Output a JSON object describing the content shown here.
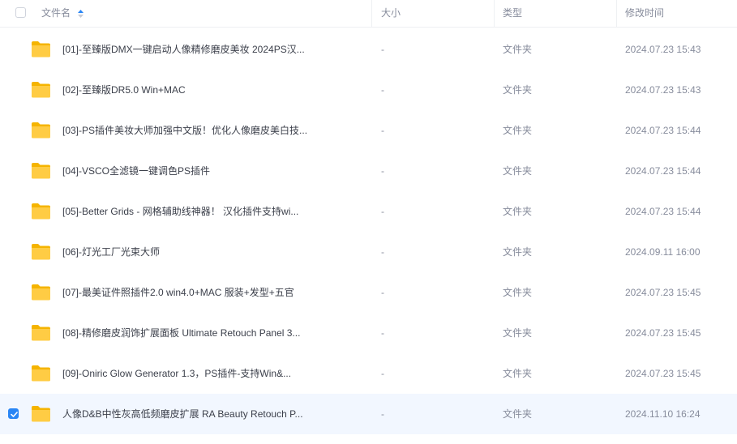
{
  "header": {
    "name": "文件名",
    "size": "大小",
    "type": "类型",
    "modified": "修改时间"
  },
  "rows": [
    {
      "name": "[01]-至臻版DMX一键启动人像精修磨皮美妆 2024PS汉...",
      "size": "-",
      "type": "文件夹",
      "modified": "2024.07.23 15:43",
      "selected": false
    },
    {
      "name": "[02]-至臻版DR5.0 Win+MAC",
      "size": "-",
      "type": "文件夹",
      "modified": "2024.07.23 15:43",
      "selected": false
    },
    {
      "name": "[03]-PS插件美妆大师加强中文版！优化人像磨皮美白技...",
      "size": "-",
      "type": "文件夹",
      "modified": "2024.07.23 15:44",
      "selected": false
    },
    {
      "name": "[04]-VSCO全滤镜一键调色PS插件",
      "size": "-",
      "type": "文件夹",
      "modified": "2024.07.23 15:44",
      "selected": false
    },
    {
      "name": "[05]-Better Grids - 网格辅助线神器！ 汉化插件支持wi...",
      "size": "-",
      "type": "文件夹",
      "modified": "2024.07.23 15:44",
      "selected": false
    },
    {
      "name": "[06]-灯光工厂光束大师",
      "size": "-",
      "type": "文件夹",
      "modified": "2024.09.11 16:00",
      "selected": false
    },
    {
      "name": "[07]-最美证件照插件2.0 win4.0+MAC 服装+发型+五官",
      "size": "-",
      "type": "文件夹",
      "modified": "2024.07.23 15:45",
      "selected": false
    },
    {
      "name": "[08]-精修磨皮润饰扩展面板 Ultimate Retouch Panel 3...",
      "size": "-",
      "type": "文件夹",
      "modified": "2024.07.23 15:45",
      "selected": false
    },
    {
      "name": "[09]-Oniric Glow Generator 1.3，PS插件-支持Win&...",
      "size": "-",
      "type": "文件夹",
      "modified": "2024.07.23 15:45",
      "selected": false
    },
    {
      "name": "人像D&B中性灰高低频磨皮扩展 RA Beauty Retouch P...",
      "size": "-",
      "type": "文件夹",
      "modified": "2024.11.10 16:24",
      "selected": true
    }
  ],
  "icons": {
    "folder": "folder-icon",
    "sort": "sort-ascending-icon",
    "check": "checkmark-icon"
  },
  "colors": {
    "accent": "#2a86f5",
    "folder": "#ffcc44",
    "selected_row": "#f2f7ff"
  }
}
